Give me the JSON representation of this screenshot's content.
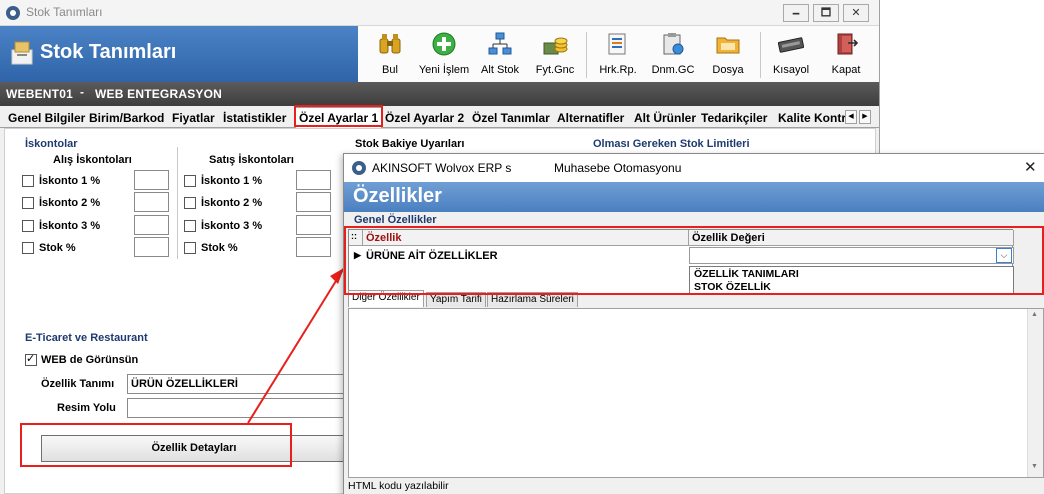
{
  "main_window": {
    "title": "Stok Tanımları",
    "buttons": {
      "minimize": "🗕",
      "maximize": "🗖",
      "close": "✕"
    }
  },
  "header": {
    "title": "Stok Tanımları",
    "toolbar": [
      {
        "name": "bul",
        "label": "Bul"
      },
      {
        "name": "yeni-islem",
        "label": "Yeni İşlem"
      },
      {
        "name": "alt-stok",
        "label": "Alt Stok"
      },
      {
        "name": "fyt-gnc",
        "label": "Fyt.Gnc"
      },
      {
        "name": "hrk-rp",
        "label": "Hrk.Rp."
      },
      {
        "name": "dnm-gc",
        "label": "Dnm.GC"
      },
      {
        "name": "dosya",
        "label": "Dosya"
      },
      {
        "name": "kisayol",
        "label": "Kısayol"
      },
      {
        "name": "kapat",
        "label": "Kapat"
      }
    ]
  },
  "subbar": {
    "code": "WEBENT01",
    "separator": "-",
    "name": "WEB ENTEGRASYON"
  },
  "tabs": [
    "Genel Bilgiler",
    "Birim/Barkod",
    "Fiyatlar",
    "İstatistikler",
    "Özel Ayarlar 1",
    "Özel Ayarlar 2",
    "Özel Tanımlar",
    "Alternatifler",
    "Alt Ürünler",
    "Tedarikçiler",
    "Kalite Kontr"
  ],
  "iskontolar": {
    "title": "İskontolar",
    "alis_title": "Alış İskontoları",
    "satis_title": "Satış İskontoları",
    "items": [
      "İskonto 1 %",
      "İskonto 2 %",
      "İskonto 3 %",
      "Stok %"
    ]
  },
  "stok_bakiye": {
    "title": "Stok Bakiye Uyarıları"
  },
  "olmasi_gereken": {
    "title": "Olması Gereken Stok Limitleri"
  },
  "eticaret": {
    "title": "E-Ticaret ve Restaurant",
    "web_checkbox": "WEB de Görünsün",
    "web_checked": true,
    "ozellik_tanimi_label": "Özellik Tanımı",
    "ozellik_tanimi_value": "ÜRÜN ÖZELLİKLERİ",
    "resim_yolu_label": "Resim Yolu",
    "resim_yolu_value": "",
    "detail_button": "Özellik Detayları"
  },
  "dialog": {
    "title": "AKINSOFT Wolvox ERP s",
    "subtitle": "Muhasebe Otomasyonu",
    "close": "✕",
    "header": "Özellikler",
    "group_title": "Genel Özellikler",
    "columns": [
      "Özellik",
      "Özellik Değeri"
    ],
    "row": {
      "property": "ÜRÜNE AİT ÖZELLİKLER",
      "value": ""
    },
    "dropdown_options": [
      "ÖZELLİK TANIMLARI",
      "STOK ÖZELLİK"
    ],
    "subtabs": [
      "Diğer Özellikler",
      "Yapım Tarifi",
      "Hazırlama Süreleri"
    ],
    "footer": "HTML kodu yazılabilir"
  },
  "colors": {
    "highlight": "#e8201b",
    "header_blue": "#3a6fb3",
    "dialog_header": "#5b8ecb"
  }
}
